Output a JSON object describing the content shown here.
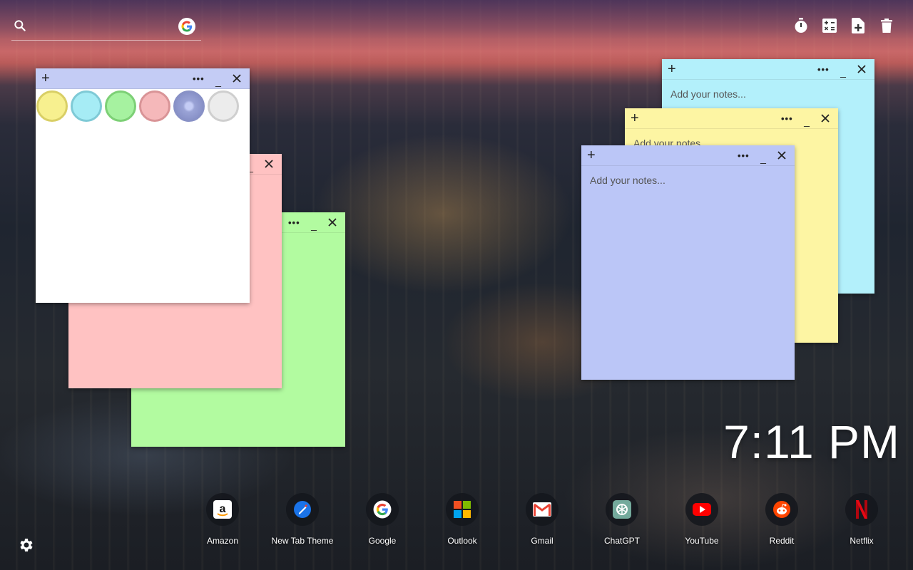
{
  "search": {
    "placeholder": ""
  },
  "toolbar": {
    "icons": [
      "timer-icon",
      "calculator-icon",
      "add-note-icon",
      "trash-icon"
    ]
  },
  "notes": {
    "palette": {
      "header_color": "#c4ccf5",
      "body_color": "#ffffff",
      "swatches": [
        "#f7f08f",
        "#a6ecf5",
        "#a6f2a0",
        "#f5b8ba",
        "#9aa3d6",
        "#e8e8e8"
      ]
    },
    "pink": {
      "color": "#ffc2c2"
    },
    "green": {
      "color": "#b2fba0"
    },
    "cyan": {
      "color": "#b3f0fb",
      "placeholder": "Add your notes..."
    },
    "yellow": {
      "color": "#fdf5a3",
      "placeholder": "Add your notes..."
    },
    "blue": {
      "color": "#bbc6f7",
      "placeholder": "Add your notes..."
    },
    "add_symbol": "+",
    "more_symbol": "•••",
    "min_symbol": "_"
  },
  "clock": {
    "time": "7:11 PM"
  },
  "dock": {
    "items": [
      {
        "label": "Amazon",
        "icon": "amazon-icon"
      },
      {
        "label": "New Tab Theme",
        "icon": "new-tab-theme-icon"
      },
      {
        "label": "Google",
        "icon": "google-icon"
      },
      {
        "label": "Outlook",
        "icon": "outlook-icon"
      },
      {
        "label": "Gmail",
        "icon": "gmail-icon"
      },
      {
        "label": "ChatGPT",
        "icon": "chatgpt-icon"
      },
      {
        "label": "YouTube",
        "icon": "youtube-icon"
      },
      {
        "label": "Reddit",
        "icon": "reddit-icon"
      },
      {
        "label": "Netflix",
        "icon": "netflix-icon"
      }
    ]
  }
}
